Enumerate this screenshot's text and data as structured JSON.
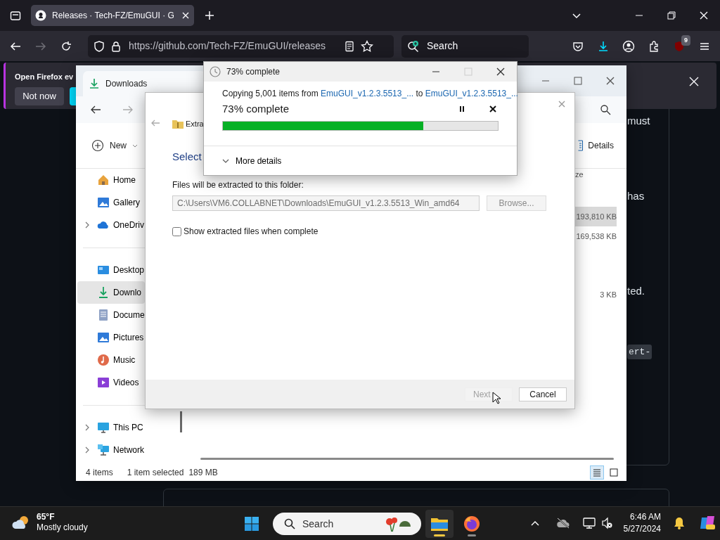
{
  "browser": {
    "tab": {
      "title": "Releases · Tech-FZ/EmuGUI · G",
      "selected": true
    },
    "address": {
      "url": "https://github.com/Tech-FZ/EmuGUI/releases"
    },
    "search": {
      "placeholder": "Search"
    },
    "extension_badge": "9",
    "notification": {
      "message": "Open Firefox ev",
      "buttons": [
        "Not now"
      ]
    }
  },
  "page": {
    "fragments": [
      {
        "kind": "text",
        "text": "must"
      },
      {
        "kind": "text",
        "text": "has"
      },
      {
        "kind": "text",
        "text": "ted."
      },
      {
        "kind": "code",
        "text": "ert-"
      }
    ]
  },
  "explorer": {
    "title": "Downloads",
    "new_button": "New",
    "details_button": "Details",
    "sidebar": {
      "groups": [
        [
          {
            "label": "Home",
            "expandable": false,
            "selected": false
          },
          {
            "label": "Gallery",
            "expandable": false,
            "selected": false
          },
          {
            "label": "OneDriv",
            "expandable": true,
            "selected": false
          }
        ],
        [
          {
            "label": "Desktop",
            "expandable": false,
            "selected": false
          },
          {
            "label": "Downlo",
            "expandable": false,
            "selected": true
          },
          {
            "label": "Docume",
            "expandable": false,
            "selected": false
          },
          {
            "label": "Pictures",
            "expandable": false,
            "selected": false
          },
          {
            "label": "Music",
            "expandable": false,
            "selected": false
          },
          {
            "label": "Videos",
            "expandable": false,
            "selected": false
          }
        ],
        [
          {
            "label": "This PC",
            "expandable": true,
            "selected": false
          },
          {
            "label": "Network",
            "expandable": true,
            "selected": false
          }
        ]
      ]
    },
    "size_column": {
      "header": "ze",
      "rows": [
        {
          "size": "193,810 KB",
          "selected": true
        },
        {
          "size": "169,538 KB",
          "selected": false
        },
        {
          "size": "3 KB",
          "selected": false
        }
      ]
    },
    "status": {
      "count": "4 items",
      "selection": "1 item selected",
      "size": "189 MB"
    },
    "views": [
      {
        "kind": "details",
        "selected": true
      },
      {
        "kind": "tiles",
        "selected": false
      }
    ]
  },
  "extract_dialog": {
    "title": "Extra",
    "heading": "Select",
    "folder_label": "Files will be extracted to this folder:",
    "path": "C:\\Users\\VM6.COLLABNET\\Downloads\\EmuGUI_v1.2.3.5513_Win_amd64",
    "browse": {
      "label": "Browse...",
      "disabled": true
    },
    "show_files": {
      "label": "Show extracted files when complete",
      "checked": false
    },
    "buttons": [
      {
        "label": "Next",
        "disabled": true
      },
      {
        "label": "Cancel",
        "disabled": false
      }
    ]
  },
  "copy_dialog": {
    "title": "73% complete",
    "summary_prefix": "Copying 5,001 items from ",
    "source": "EmuGUI_v1.2.3.5513_...",
    "joiner": " to ",
    "destination": "EmuGUI_v1.2.3.5513_...",
    "status": "73% complete",
    "level": 0.73,
    "more_details": "More details"
  },
  "taskbar": {
    "weather": {
      "temperature": "65°F",
      "condition": "Mostly cloudy"
    },
    "search": {
      "placeholder": "Search"
    },
    "apps": [
      {
        "kind": "explorer",
        "selected": true
      },
      {
        "kind": "firefox",
        "selected": false
      }
    ],
    "time": "6:46 AM",
    "date": "5/27/2024"
  }
}
